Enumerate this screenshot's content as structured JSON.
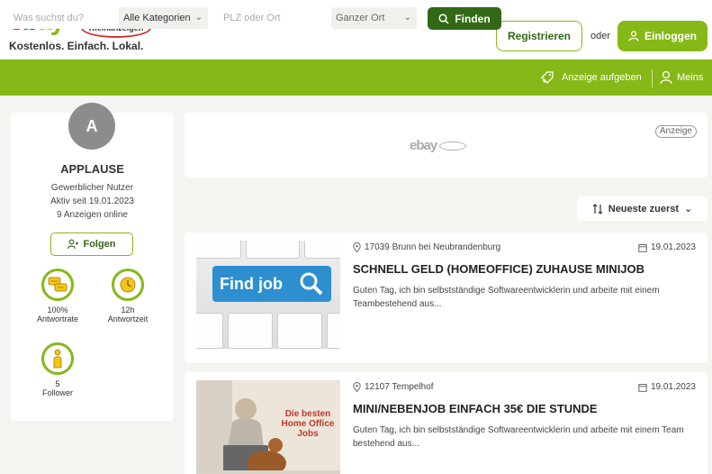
{
  "header": {
    "logo_letters": [
      "e",
      "b",
      "a",
      "y"
    ],
    "logo_badge": "Kleinanzeigen",
    "slogan": "Kostenlos. Einfach. Lokal.",
    "register_label": "Registrieren",
    "or_text": "oder",
    "login_label": "Einloggen"
  },
  "search": {
    "query_placeholder": "Was suchst du?",
    "category_value": "Alle Kategorien",
    "location_placeholder": "PLZ oder Ort",
    "radius_value": "Ganzer Ort",
    "find_label": "Finden",
    "post_ad_label": "Anzeige aufgeben",
    "account_label": "Meins"
  },
  "profile": {
    "avatar_letter": "A",
    "name": "APPLAUSE",
    "user_type": "Gewerblicher Nutzer",
    "active_since": "Aktiv seit 19.01.2023",
    "ads_online": "9 Anzeigen online",
    "follow_label": "Folgen",
    "badges": [
      {
        "value": "100%",
        "label": "Antwortrate",
        "icon": "response-rate-icon"
      },
      {
        "value": "12h",
        "label": "Antwortzeit",
        "icon": "response-time-icon"
      },
      {
        "value": "5",
        "label": "Follower",
        "icon": "follower-icon"
      }
    ]
  },
  "ad_banner": {
    "logo_text": "ebay",
    "tag": "Anzeige"
  },
  "sort": {
    "label": "Neueste zuerst"
  },
  "listings": [
    {
      "location": "17039 Brunn bei Neubrandenburg",
      "date": "19.01.2023",
      "title": "SCHNELL GELD (HOMEOFFICE) ZUHAUSE MINIJOB",
      "description": "Guten Tag, ich bin selbstständige Softwareentwicklerin und arbeite mit einem Teambestehend aus...",
      "image_text": "Find job"
    },
    {
      "location": "12107 Tempelhof",
      "date": "19.01.2023",
      "title": "MINI/NEBENJOB EINFACH 35€ DIE STUNDE",
      "description": "Guten Tag, ich bin selbstständige Softwareentwicklerin und arbeite mit einem Team bestehend aus...",
      "image_text": "Die besten Home Office Jobs"
    }
  ],
  "colors": {
    "brand_green": "#86b817",
    "dark_green": "#326916"
  }
}
